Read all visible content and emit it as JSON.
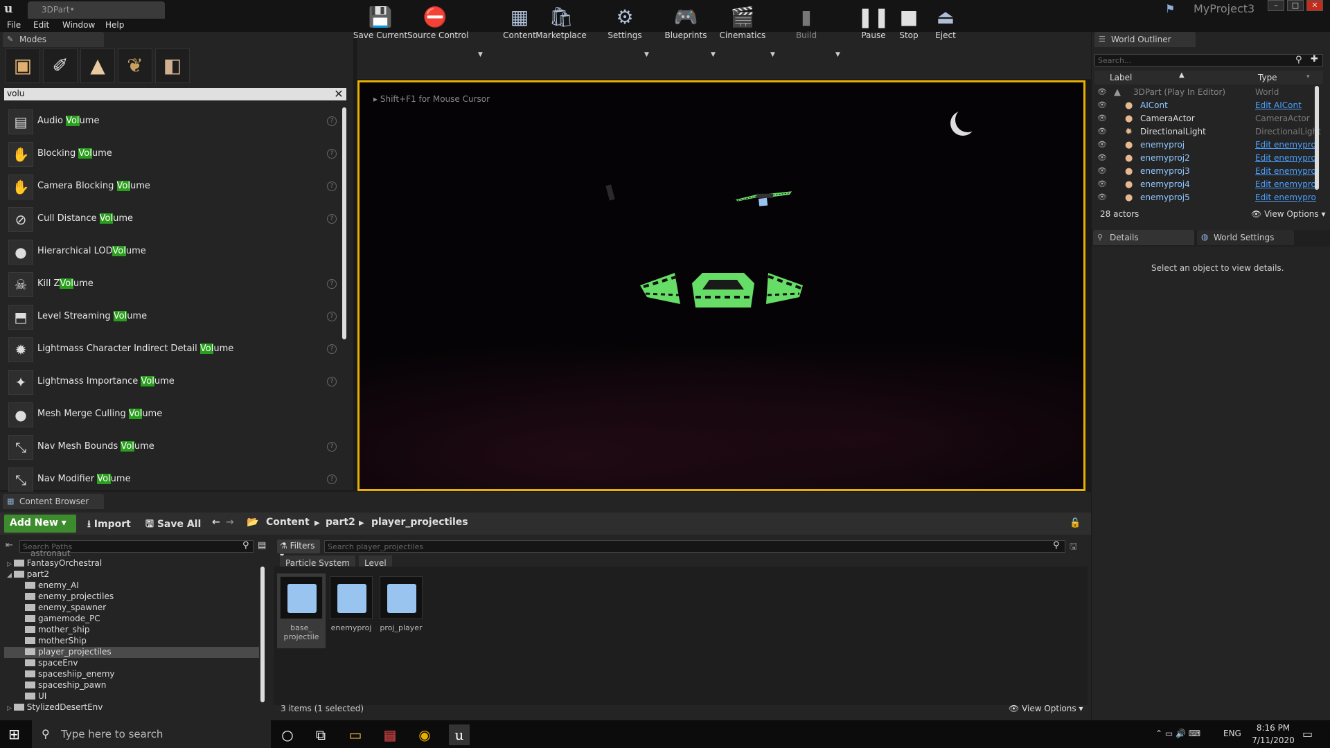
{
  "titlebar": {
    "doc_tab": "3DPart•",
    "project": "MyProject3",
    "min": "–",
    "max": "□",
    "close": "✕"
  },
  "menu": [
    "File",
    "Edit",
    "Window",
    "Help"
  ],
  "modes": {
    "tab": "Modes",
    "search_value": "volu",
    "items": [
      {
        "pre": "Audio ",
        "hl": "Vol",
        "post": "ume",
        "icon": "speaker-icon",
        "glyph": "▤"
      },
      {
        "pre": "Blocking ",
        "hl": "Vol",
        "post": "ume",
        "icon": "hand-icon",
        "glyph": "✋"
      },
      {
        "pre": "Camera Blocking ",
        "hl": "Vol",
        "post": "ume",
        "icon": "camera-blocking-icon",
        "glyph": "✋"
      },
      {
        "pre": "Cull Distance ",
        "hl": "Vol",
        "post": "ume",
        "icon": "cull-distance-icon",
        "glyph": "⊘"
      },
      {
        "pre": "Hierarchical LOD",
        "hl": "Vol",
        "post": "ume",
        "icon": "sphere-icon",
        "glyph": "●"
      },
      {
        "pre": "Kill Z",
        "hl": "Vol",
        "post": "ume",
        "icon": "kill-z-icon",
        "glyph": "☠"
      },
      {
        "pre": "Level Streaming ",
        "hl": "Vol",
        "post": "ume",
        "icon": "level-streaming-icon",
        "glyph": "⬒"
      },
      {
        "pre": "Lightmass Character Indirect Detail ",
        "hl": "Vol",
        "post": "ume",
        "icon": "light-icon",
        "glyph": "✹"
      },
      {
        "pre": "Lightmass Importance ",
        "hl": "Vol",
        "post": "ume",
        "icon": "lightmass-importance-icon",
        "glyph": "✦"
      },
      {
        "pre": "Mesh Merge Culling ",
        "hl": "Vol",
        "post": "ume",
        "icon": "sphere-icon",
        "glyph": "●"
      },
      {
        "pre": "Nav Mesh Bounds ",
        "hl": "Vol",
        "post": "ume",
        "icon": "nav-mesh-icon",
        "glyph": "⤡"
      },
      {
        "pre": "Nav Modifier ",
        "hl": "Vol",
        "post": "ume",
        "icon": "nav-modifier-icon",
        "glyph": "⤡"
      }
    ]
  },
  "toolbar": [
    {
      "label": "Save Current",
      "icon": "save-icon",
      "glyph": "💾"
    },
    {
      "label": "Source Control",
      "icon": "source-control-icon",
      "glyph": "⛔"
    },
    {
      "label": "Content",
      "icon": "content-icon",
      "glyph": "▦"
    },
    {
      "label": "Marketplace",
      "icon": "marketplace-icon",
      "glyph": "🛍"
    },
    {
      "label": "Settings",
      "icon": "settings-icon",
      "glyph": "⚙"
    },
    {
      "label": "Blueprints",
      "icon": "blueprints-icon",
      "glyph": "🎮"
    },
    {
      "label": "Cinematics",
      "icon": "cinematics-icon",
      "glyph": "🎬"
    },
    {
      "label": "Build",
      "icon": "build-icon",
      "glyph": "▮"
    },
    {
      "label": "Pause",
      "icon": "pause-icon",
      "glyph": "❚❚"
    },
    {
      "label": "Stop",
      "icon": "stop-icon",
      "glyph": "■"
    },
    {
      "label": "Eject",
      "icon": "eject-icon",
      "glyph": "⏏"
    }
  ],
  "viewport": {
    "hint": "Shift+F1 for Mouse Cursor"
  },
  "outliner": {
    "tab": "World Outliner",
    "search_placeholder": "Search...",
    "col_label": "Label",
    "col_type": "Type",
    "rows": [
      {
        "name": "3DPart (Play In Editor)",
        "type": "World",
        "link": false
      },
      {
        "name": "AICont",
        "type": "Edit AICont",
        "link": true
      },
      {
        "name": "CameraActor",
        "type": "CameraActor",
        "link": false
      },
      {
        "name": "DirectionalLight",
        "type": "DirectionalLight",
        "link": false
      },
      {
        "name": "enemyproj",
        "type": "Edit enemypro",
        "link": true
      },
      {
        "name": "enemyproj2",
        "type": "Edit enemypro",
        "link": true
      },
      {
        "name": "enemyproj3",
        "type": "Edit enemypro",
        "link": true
      },
      {
        "name": "enemyproj4",
        "type": "Edit enemypro",
        "link": true
      },
      {
        "name": "enemyproj5",
        "type": "Edit enemypro",
        "link": true
      }
    ],
    "actor_count": "28 actors",
    "view_options": "View Options"
  },
  "details": {
    "tab1": "Details",
    "tab2": "World Settings",
    "empty": "Select an object to view details."
  },
  "content_browser": {
    "tab": "Content Browser",
    "add_new": "Add New",
    "import": "Import",
    "save_all": "Save All",
    "breadcrumb": [
      "Content",
      "part2",
      "player_projectiles"
    ],
    "path_search_placeholder": "Search Paths",
    "filters": "Filters",
    "asset_search_placeholder": "Search player_projectiles",
    "chips": [
      "Particle System",
      "Level"
    ],
    "tree_top": "astronaut",
    "tree": [
      {
        "label": "FantasyOrchestral",
        "depth": 0
      },
      {
        "label": "part2",
        "depth": 0
      },
      {
        "label": "enemy_AI",
        "depth": 1
      },
      {
        "label": "enemy_projectiles",
        "depth": 1
      },
      {
        "label": "enemy_spawner",
        "depth": 1
      },
      {
        "label": "gamemode_PC",
        "depth": 1
      },
      {
        "label": "mother_ship",
        "depth": 1
      },
      {
        "label": "motherShip",
        "depth": 1
      },
      {
        "label": "player_projectiles",
        "depth": 1
      },
      {
        "label": "spaceEnv",
        "depth": 1
      },
      {
        "label": "spaceshiip_enemy",
        "depth": 1
      },
      {
        "label": "spaceship_pawn",
        "depth": 1
      },
      {
        "label": "UI",
        "depth": 1
      },
      {
        "label": "StylizedDesertEnv",
        "depth": 0
      }
    ],
    "assets": [
      {
        "label": "base_\nprojectile"
      },
      {
        "label": "enemyproj"
      },
      {
        "label": "proj_player"
      }
    ],
    "status": "3 items (1 selected)",
    "view_options": "View Options"
  },
  "taskbar": {
    "search_placeholder": "Type here to search",
    "lang": "ENG",
    "time": "8:16 PM",
    "date": "7/11/2020"
  }
}
